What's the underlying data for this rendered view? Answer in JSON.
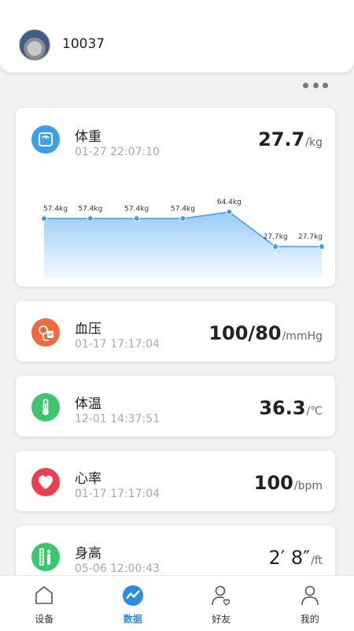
{
  "header": {
    "username": "10037"
  },
  "cards": {
    "weight": {
      "title": "体重",
      "time": "01-27 22:07:10",
      "value": "27.7",
      "unit": "/kg",
      "color": "#3aa0ee"
    },
    "blood_pressure": {
      "title": "血压",
      "time": "01-17 17:17:04",
      "value": "100/80",
      "unit": "/mmHg",
      "color": "#f06a3c"
    },
    "temperature": {
      "title": "体温",
      "time": "12-01 14:37:51",
      "value": "36.3",
      "unit": "/℃",
      "color": "#3cc66e"
    },
    "heart_rate": {
      "title": "心率",
      "time": "01-17 17:17:04",
      "value": "100",
      "unit": "/bpm",
      "color": "#ee3e4e"
    },
    "height": {
      "title": "身高",
      "time": "05-06 12:00:43",
      "value": "2′ 8″",
      "unit": "/ft",
      "color": "#3cc66e"
    }
  },
  "chart_data": {
    "type": "area",
    "points": [
      57.4,
      57.4,
      57.4,
      57.4,
      64.4,
      27.7,
      27.7
    ],
    "labels": [
      "57.4kg",
      "57.4kg",
      "57.4kg",
      "57.4kg",
      "64.4kg",
      "27.7kg",
      "27.7kg"
    ],
    "color": "#3aa0ee"
  },
  "tabbar": {
    "items": [
      {
        "label": "设备",
        "icon": "device-icon",
        "active": false
      },
      {
        "label": "数据",
        "icon": "data-chart-icon",
        "active": true
      },
      {
        "label": "好友",
        "icon": "friends-icon",
        "active": false
      },
      {
        "label": "我的",
        "icon": "profile-icon",
        "active": false
      }
    ],
    "active_color": "#2a8ee0"
  }
}
